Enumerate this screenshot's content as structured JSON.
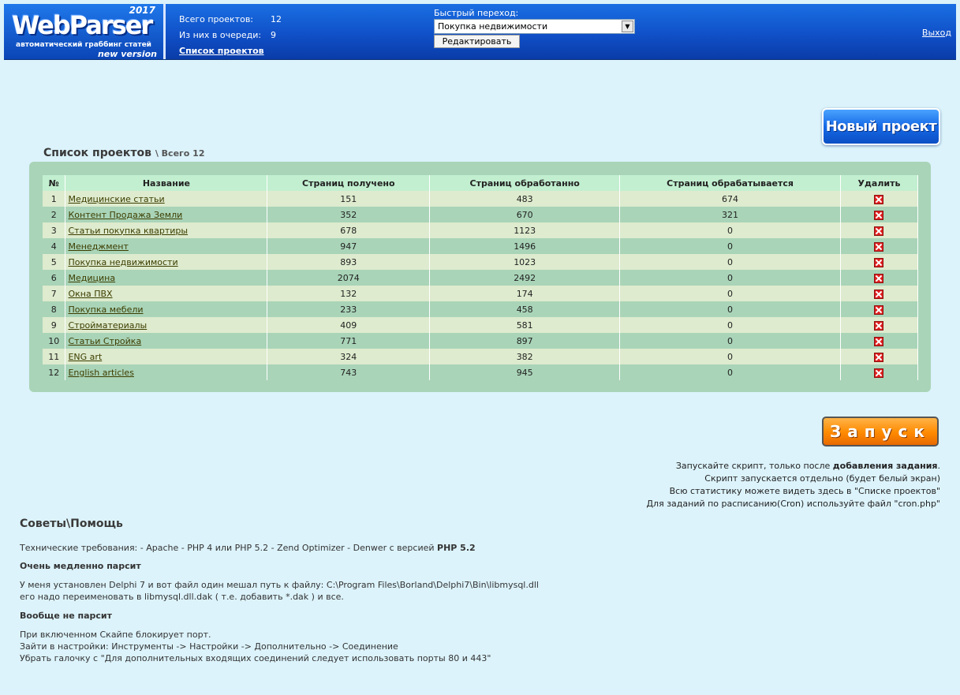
{
  "logo": {
    "year": "2017",
    "name": "WebParser",
    "tagline": "автоматический граббинг статей",
    "version": "new version"
  },
  "header": {
    "total_label": "Всего проектов:",
    "total_value": "12",
    "queue_label": "Из них в очереди:",
    "queue_value": "9",
    "list_link": "Список проектов",
    "quick_label": "Быстрый переход:",
    "quick_selected": "Покупка недвижимости",
    "edit_button": "Редактировать",
    "logout": "Выход"
  },
  "new_project_button": "Новый проект",
  "list": {
    "title": "Список проектов",
    "total": "\\ Всего 12",
    "columns": [
      "№",
      "Название",
      "Страниц получено",
      "Страниц обработанно",
      "Страниц обрабатывается",
      "Удалить"
    ],
    "rows": [
      {
        "n": "1",
        "name": "Медицинские статьи",
        "got": "151",
        "done": "483",
        "proc": "674"
      },
      {
        "n": "2",
        "name": "Контент Продажа Земли",
        "got": "352",
        "done": "670",
        "proc": "321"
      },
      {
        "n": "3",
        "name": "Статьи покупка квартиры",
        "got": "678",
        "done": "1123",
        "proc": "0"
      },
      {
        "n": "4",
        "name": "Менеджмент",
        "got": "947",
        "done": "1496",
        "proc": "0"
      },
      {
        "n": "5",
        "name": "Покупка недвижимости",
        "got": "893",
        "done": "1023",
        "proc": "0"
      },
      {
        "n": "6",
        "name": "Медицина",
        "got": "2074",
        "done": "2492",
        "proc": "0"
      },
      {
        "n": "7",
        "name": "Окна ПВХ",
        "got": "132",
        "done": "174",
        "proc": "0"
      },
      {
        "n": "8",
        "name": "Покупка мебели",
        "got": "233",
        "done": "458",
        "proc": "0"
      },
      {
        "n": "9",
        "name": "Стройматериалы",
        "got": "409",
        "done": "581",
        "proc": "0"
      },
      {
        "n": "10",
        "name": "Статьи Стройка",
        "got": "771",
        "done": "897",
        "proc": "0"
      },
      {
        "n": "11",
        "name": "ENG art",
        "got": "324",
        "done": "382",
        "proc": "0"
      },
      {
        "n": "12",
        "name": "English articles",
        "got": "743",
        "done": "945",
        "proc": "0"
      }
    ]
  },
  "run": {
    "button": "Запуск",
    "note1_pre": "Запускайте скрипт, только после ",
    "note1_bold": "добавления задания",
    "note1_post": ".",
    "note2": "Скрипт запускается отдельно (будет белый экран)",
    "note3": "Всю статистику можете видеть здесь в \"Списке проектов\"",
    "note4": "Для заданий по расписанию(Cron) используйте файл \"cron.php\""
  },
  "help": {
    "title": "Советы\\Помощь",
    "req_pre": "Технические требования: - Apache - PHP 4 или PHP 5.2 - Zend Optimizer - Denwer с версией ",
    "req_bold": "PHP 5.2",
    "q1": "Очень медленно парсит",
    "a1_line1": "У меня установлен Delphi 7 и вот файл один мешал путь к файлу: C:\\Program Files\\Borland\\Delphi7\\Bin\\libmysql.dll",
    "a1_line2": "его надо переименовать в libmysql.dll.dak ( т.е. добавить *.dak ) и все.",
    "q2": "Вообще не парсит",
    "a2_line1": "При включенном Скайпе блокирует порт.",
    "a2_line2": "Зайти в настройки: Инструменты -> Настройки -> Дополнительно -> Соединение",
    "a2_line3": "Убрать галочку с \"Для дополнительных входящих соединений следует использовать порты 80 и 443\""
  }
}
